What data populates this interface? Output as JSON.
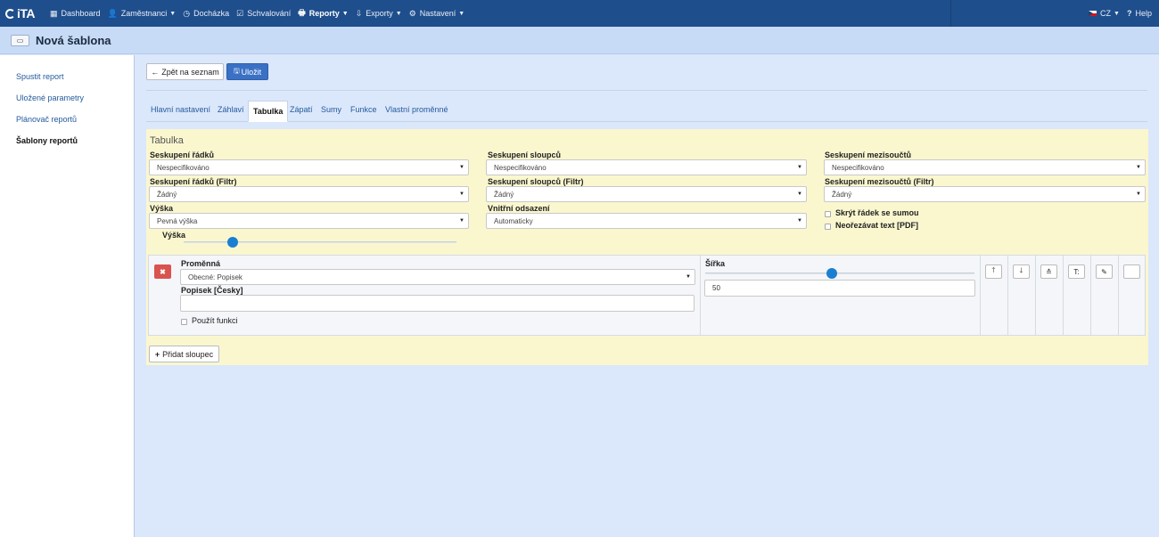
{
  "nav": {
    "logo": "iTA",
    "items": [
      {
        "icon": "▦",
        "label": "Dashboard",
        "caret": ""
      },
      {
        "icon": "👤",
        "label": "Zaměstnanci",
        "caret": "▼"
      },
      {
        "icon": "◷",
        "label": "Docházka",
        "caret": ""
      },
      {
        "icon": "☑",
        "label": "Schvalování",
        "caret": ""
      },
      {
        "icon": "🖶",
        "label": "Reporty",
        "caret": "▼"
      },
      {
        "icon": "⇩",
        "label": "Exporty",
        "caret": "▼"
      },
      {
        "icon": "⚙",
        "label": "Nastavení",
        "caret": "▼"
      }
    ],
    "lang": "CZ",
    "lang_caret": "▼",
    "help_icon": "?",
    "help": "Help"
  },
  "header": {
    "icon": "▭",
    "title": "Nová šablona"
  },
  "sidebar": {
    "items": [
      {
        "label": "Spustit report"
      },
      {
        "label": "Uložené parametry"
      },
      {
        "label": "Plánovač reportů"
      },
      {
        "label": "Šablony reportů"
      }
    ]
  },
  "toolbar": {
    "back_icon": "←",
    "back": "Zpět na seznam",
    "save_icon": "🖫",
    "save": "Uložit"
  },
  "tabs": [
    "Hlavní nastavení",
    "Záhlaví",
    "Tabulka",
    "Zápatí",
    "Sumy",
    "Funkce",
    "Vlastní proměnné"
  ],
  "table": {
    "title": "Tabulka",
    "row_group": {
      "label": "Seskupení řádků",
      "value": "Nespecifikováno"
    },
    "col_group": {
      "label": "Seskupení sloupců",
      "value": "Nespecifikováno"
    },
    "subtotal_group": {
      "label": "Seskupení mezisoučtů",
      "value": "Nespecifikováno"
    },
    "row_filter": {
      "label": "Seskupení řádků (Filtr)",
      "value": "Žádný"
    },
    "col_filter": {
      "label": "Seskupení sloupců (Filtr)",
      "value": "Žádný"
    },
    "subtotal_filter": {
      "label": "Seskupení mezisoučtů (Filtr)",
      "value": "Žádný"
    },
    "height": {
      "label": "Výška",
      "value": "Pevná výška"
    },
    "padding": {
      "label": "Vnitřní odsazení",
      "value": "Automaticky"
    },
    "hide_sum_row": "Skrýt řádek se sumou",
    "no_crop_pdf": "Neořezávat text [PDF]",
    "height_slider": {
      "label": "Výška",
      "level": 0.18
    },
    "dropdown_arrow": "▼"
  },
  "column": {
    "delete_icon": "✖",
    "variable": {
      "label": "Proměnná",
      "value": "Obecné: Popisek"
    },
    "caption": {
      "label": "Popisek [Česky]",
      "value": ""
    },
    "use_function": "Použít funkci",
    "width": {
      "label": "Šířka",
      "value": "50",
      "level": 0.47
    },
    "buttons": [
      "🡑",
      "🡓",
      "≛",
      "T:",
      "✎",
      ""
    ]
  },
  "add_column": {
    "icon": "+",
    "label": "Přidat sloupec"
  }
}
